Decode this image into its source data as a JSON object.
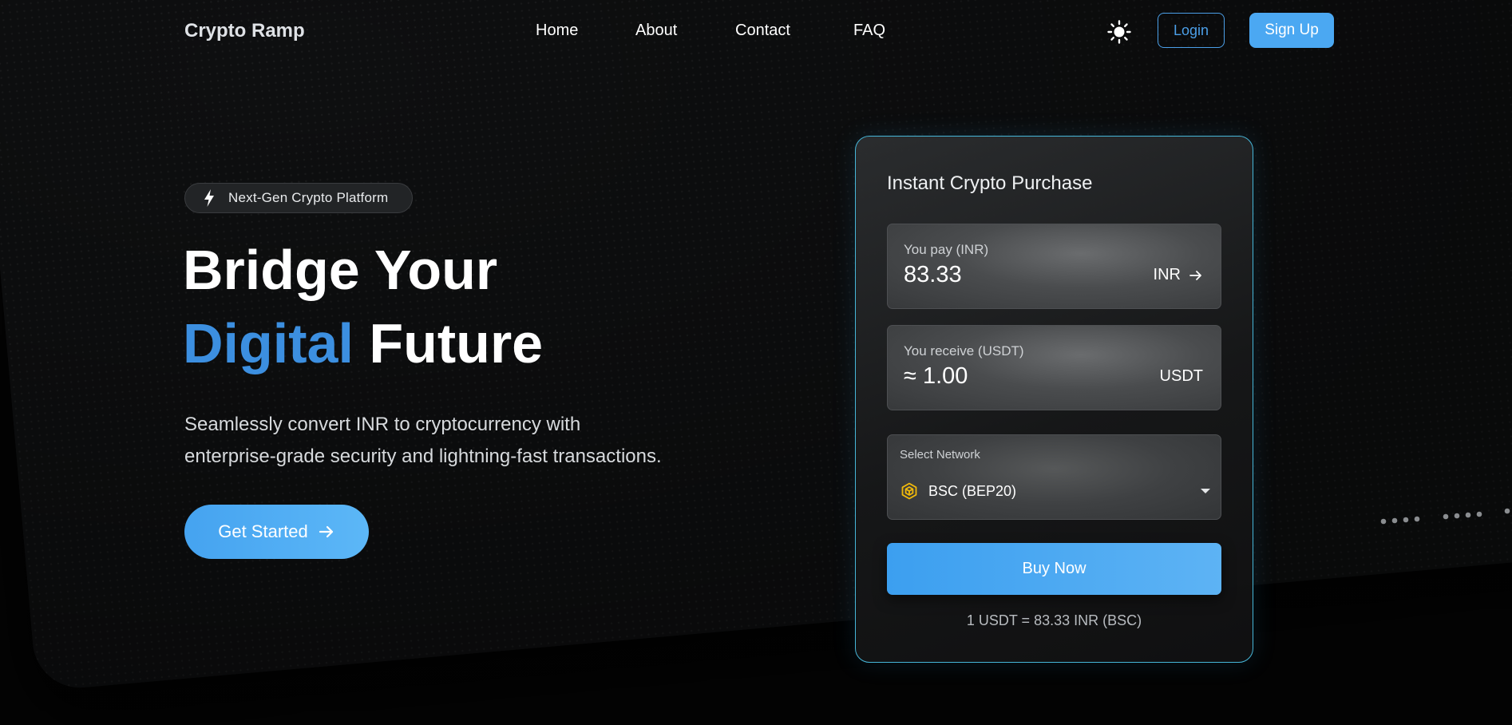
{
  "nav": {
    "brand": "Crypto Ramp",
    "links": [
      "Home",
      "About",
      "Contact",
      "FAQ"
    ],
    "login_label": "Login",
    "signup_label": "Sign Up",
    "theme_icon": "sun-icon"
  },
  "hero": {
    "badge_icon": "lightning-icon",
    "badge_text": "Next-Gen Crypto Platform",
    "title_line1": "Bridge Your",
    "title_accent": "Digital",
    "title_line2_rest": " Future",
    "subtitle_line1": "Seamlessly convert INR to cryptocurrency with",
    "subtitle_line2": "enterprise-grade security and lightning-fast transactions.",
    "cta_label": "Get Started"
  },
  "purchase": {
    "title": "Instant Crypto Purchase",
    "pay": {
      "label": "You pay (INR)",
      "value": "83.33",
      "currency": "INR"
    },
    "receive": {
      "label": "You receive (USDT)",
      "value": "≈ 1.00",
      "currency": "USDT"
    },
    "network": {
      "label": "Select Network",
      "selected": "BSC (BEP20)",
      "icon": "bnb-icon"
    },
    "buy_label": "Buy Now",
    "rate_text": "1 USDT = 83.33 INR (BSC)"
  },
  "colors": {
    "accent": "#3c8fe0",
    "button_blue": "#4ba8f2",
    "card_border": "#46b6d8",
    "background": "#050505"
  }
}
